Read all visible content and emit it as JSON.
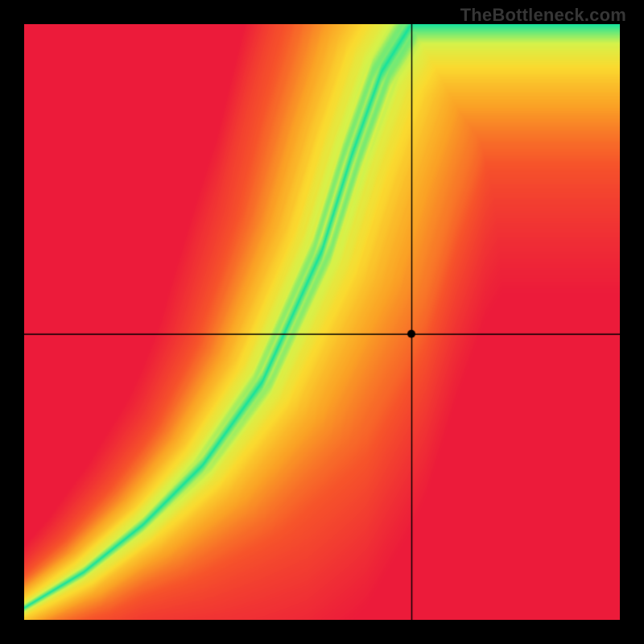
{
  "watermark": "TheBottleneck.com",
  "chart_data": {
    "type": "heatmap",
    "title": "",
    "xlabel": "",
    "ylabel": "",
    "xlim": [
      0,
      1
    ],
    "ylim": [
      0,
      1
    ],
    "crosshair": {
      "x": 0.65,
      "y": 0.48
    },
    "point": {
      "x": 0.65,
      "y": 0.48
    },
    "ridge": {
      "description": "Center of the green optimal band as y(x); intermediate points linearly interpolated.",
      "x": [
        0.0,
        0.1,
        0.2,
        0.3,
        0.4,
        0.5,
        0.55,
        0.6,
        0.65,
        0.7
      ],
      "y": [
        0.02,
        0.08,
        0.16,
        0.26,
        0.4,
        0.62,
        0.78,
        0.92,
        1.0,
        1.0
      ]
    },
    "band_halfwidth": {
      "description": "Half-width of green band (in x-units) as a function of x.",
      "x": [
        0.0,
        0.2,
        0.4,
        0.55,
        0.65
      ],
      "w": [
        0.01,
        0.02,
        0.035,
        0.045,
        0.05
      ]
    },
    "color_scale": {
      "description": "0 = on ridge (green), 1 = far from ridge (red). Interpolated stops.",
      "stops": [
        {
          "t": 0.0,
          "color": "#15e29d"
        },
        {
          "t": 0.18,
          "color": "#d6f24a"
        },
        {
          "t": 0.35,
          "color": "#fada2f"
        },
        {
          "t": 0.55,
          "color": "#faa225"
        },
        {
          "t": 0.75,
          "color": "#f6542a"
        },
        {
          "t": 1.0,
          "color": "#ec1b3a"
        }
      ]
    },
    "resolution": 200
  }
}
